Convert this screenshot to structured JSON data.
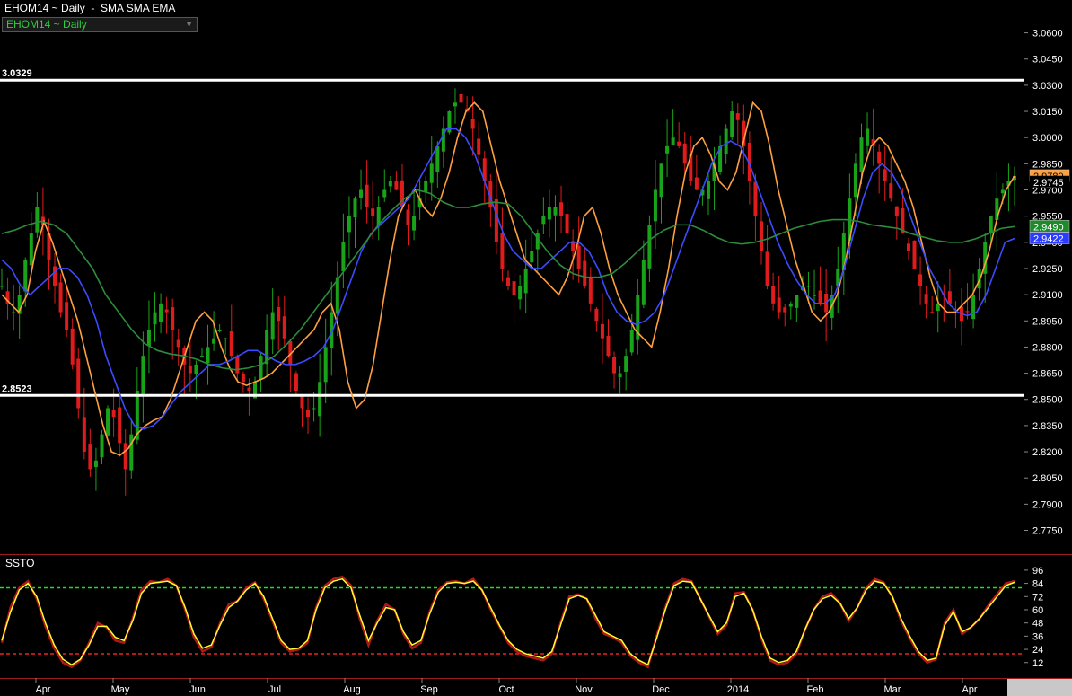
{
  "header": {
    "title": "EHOM14 ~ Daily  -  SMA SMA EMA",
    "symbol_dropdown": "EHOM14 ~ Daily"
  },
  "colors": {
    "background": "#000000",
    "up_candle": "#19a319",
    "down_candle": "#e01b1b",
    "sma_short": "#ffa040",
    "sma_long": "#3b4bff",
    "ema": "#2c8c3c",
    "support_resistance": "#ffffff",
    "stoch_k": "#b01818",
    "stoch_d": "#ffff30",
    "stoch_upper": "#22dd22",
    "stoch_lower": "#ee2222"
  },
  "chart_data": [
    {
      "type": "candlestick",
      "y_ticks": [
        "3.0600",
        "3.0450",
        "3.0300",
        "3.0150",
        "3.0000",
        "2.9850",
        "2.9700",
        "2.9550",
        "2.9400",
        "2.9250",
        "2.9100",
        "2.8950",
        "2.8800",
        "2.8650",
        "2.8500",
        "2.8350",
        "2.8200",
        "2.8050",
        "2.7900",
        "2.7750"
      ],
      "ylim": [
        2.766,
        3.0675
      ],
      "months": [
        "Apr",
        "May",
        "Jun",
        "Jul",
        "Aug",
        "Sep",
        "Oct",
        "Nov",
        "Dec",
        "2014",
        "Feb",
        "Mar",
        "Apr"
      ],
      "horizontal_lines": [
        {
          "value": 3.0329,
          "label": "3.0329"
        },
        {
          "value": 2.8523,
          "label": "2.8523"
        }
      ],
      "last_values": [
        {
          "label": "2.9780",
          "value": 2.978,
          "series": "sma_short"
        },
        {
          "label": "2.9745",
          "value": 2.9745,
          "series": "last_price"
        },
        {
          "label": "2.9490",
          "value": 2.949,
          "series": "ema"
        },
        {
          "label": "2.9422",
          "value": 2.9422,
          "series": "sma_long"
        }
      ],
      "close_series": [
        2.915,
        2.905,
        2.9,
        2.91,
        2.93,
        2.945,
        2.96,
        2.95,
        2.93,
        2.915,
        2.9,
        2.89,
        2.87,
        2.845,
        2.82,
        2.81,
        2.815,
        2.83,
        2.845,
        2.84,
        2.825,
        2.81,
        2.83,
        2.855,
        2.875,
        2.89,
        2.9,
        2.905,
        2.9,
        2.89,
        2.88,
        2.87,
        2.865,
        2.87,
        2.875,
        2.88,
        2.885,
        2.89,
        2.885,
        2.875,
        2.865,
        2.86,
        2.855,
        2.86,
        2.875,
        2.89,
        2.9,
        2.895,
        2.885,
        2.87,
        2.855,
        2.845,
        2.84,
        2.845,
        2.86,
        2.88,
        2.9,
        2.92,
        2.94,
        2.955,
        2.965,
        2.97,
        2.96,
        2.955,
        2.96,
        2.97,
        2.975,
        2.97,
        2.96,
        2.95,
        2.955,
        2.965,
        2.975,
        2.985,
        2.995,
        3.005,
        3.015,
        3.02,
        3.02,
        3.015,
        3.005,
        2.99,
        2.975,
        2.96,
        2.94,
        2.925,
        2.915,
        2.91,
        2.915,
        2.925,
        2.935,
        2.945,
        2.955,
        2.96,
        2.96,
        2.955,
        2.945,
        2.935,
        2.925,
        2.915,
        2.905,
        2.895,
        2.885,
        2.875,
        2.865,
        2.865,
        2.875,
        2.89,
        2.91,
        2.93,
        2.95,
        2.97,
        2.985,
        2.995,
        3.0,
        2.995,
        2.985,
        2.975,
        2.97,
        2.97,
        2.975,
        2.985,
        2.995,
        3.005,
        3.015,
        3.01,
        2.995,
        2.975,
        2.955,
        2.935,
        2.915,
        2.905,
        2.9,
        2.9,
        2.905,
        2.91,
        2.915,
        2.915,
        2.91,
        2.905,
        2.9,
        2.91,
        2.925,
        2.945,
        2.965,
        2.985,
        3.0,
        3.005,
        2.995,
        2.985,
        2.975,
        2.965,
        2.955,
        2.945,
        2.935,
        2.925,
        2.915,
        2.905,
        2.9,
        2.905,
        2.91,
        2.905,
        2.9,
        2.895,
        2.9,
        2.91,
        2.925,
        2.94,
        2.955,
        2.965,
        2.97,
        2.975,
        2.978
      ],
      "series": [
        {
          "key": "sma_short",
          "values": [
            2.91,
            2.905,
            2.9,
            2.91,
            2.935,
            2.952,
            2.94,
            2.925,
            2.91,
            2.895,
            2.875,
            2.855,
            2.835,
            2.82,
            2.818,
            2.822,
            2.83,
            2.835,
            2.838,
            2.84,
            2.85,
            2.865,
            2.88,
            2.895,
            2.9,
            2.895,
            2.88,
            2.868,
            2.86,
            2.858,
            2.86,
            2.862,
            2.865,
            2.87,
            2.875,
            2.88,
            2.885,
            2.89,
            2.9,
            2.905,
            2.89,
            2.86,
            2.845,
            2.85,
            2.87,
            2.9,
            2.93,
            2.955,
            2.965,
            2.97,
            2.96,
            2.955,
            2.965,
            2.98,
            3.0,
            3.015,
            3.02,
            3.015,
            2.995,
            2.975,
            2.96,
            2.945,
            2.93,
            2.925,
            2.92,
            2.915,
            2.91,
            2.92,
            2.935,
            2.955,
            2.96,
            2.945,
            2.925,
            2.91,
            2.9,
            2.89,
            2.885,
            2.88,
            2.9,
            2.925,
            2.955,
            2.98,
            2.995,
            3.0,
            2.99,
            2.975,
            2.97,
            2.98,
            3.0,
            3.02,
            3.015,
            2.995,
            2.97,
            2.95,
            2.93,
            2.915,
            2.9,
            2.895,
            2.9,
            2.91,
            2.93,
            2.955,
            2.98,
            2.995,
            3.0,
            2.995,
            2.985,
            2.975,
            2.96,
            2.94,
            2.92,
            2.905,
            2.9,
            2.9,
            2.905,
            2.91,
            2.92,
            2.935,
            2.955,
            2.97,
            2.978
          ]
        },
        {
          "key": "sma_long",
          "values": [
            2.93,
            2.925,
            2.915,
            2.91,
            2.915,
            2.92,
            2.925,
            2.925,
            2.92,
            2.91,
            2.895,
            2.875,
            2.86,
            2.845,
            2.835,
            2.833,
            2.835,
            2.84,
            2.848,
            2.855,
            2.86,
            2.865,
            2.87,
            2.87,
            2.872,
            2.875,
            2.878,
            2.878,
            2.875,
            2.872,
            2.87,
            2.87,
            2.872,
            2.875,
            2.88,
            2.89,
            2.905,
            2.92,
            2.935,
            2.945,
            2.95,
            2.955,
            2.96,
            2.965,
            2.975,
            2.985,
            2.995,
            3.005,
            3.005,
            3.0,
            2.99,
            2.975,
            2.96,
            2.945,
            2.935,
            2.93,
            2.925,
            2.925,
            2.93,
            2.935,
            2.94,
            2.94,
            2.935,
            2.925,
            2.91,
            2.9,
            2.895,
            2.893,
            2.895,
            2.9,
            2.91,
            2.925,
            2.94,
            2.955,
            2.97,
            2.985,
            2.995,
            2.998,
            2.995,
            2.985,
            2.97,
            2.955,
            2.94,
            2.928,
            2.918,
            2.91,
            2.905,
            2.905,
            2.91,
            2.925,
            2.945,
            2.965,
            2.98,
            2.985,
            2.98,
            2.97,
            2.955,
            2.94,
            2.925,
            2.915,
            2.905,
            2.9,
            2.898,
            2.9,
            2.91,
            2.925,
            2.94,
            2.9422
          ]
        },
        {
          "key": "ema",
          "values": [
            2.945,
            2.947,
            2.95,
            2.952,
            2.95,
            2.945,
            2.935,
            2.925,
            2.91,
            2.9,
            2.89,
            2.882,
            2.878,
            2.876,
            2.875,
            2.873,
            2.87,
            2.868,
            2.867,
            2.868,
            2.87,
            2.875,
            2.882,
            2.89,
            2.9,
            2.91,
            2.92,
            2.93,
            2.94,
            2.95,
            2.958,
            2.965,
            2.97,
            2.968,
            2.963,
            2.96,
            2.96,
            2.962,
            2.963,
            2.962,
            2.955,
            2.945,
            2.935,
            2.927,
            2.922,
            2.92,
            2.92,
            2.922,
            2.928,
            2.935,
            2.942,
            2.947,
            2.95,
            2.95,
            2.947,
            2.943,
            2.94,
            2.939,
            2.94,
            2.942,
            2.945,
            2.948,
            2.95,
            2.952,
            2.953,
            2.953,
            2.952,
            2.95,
            2.949,
            2.948,
            2.945,
            2.943,
            2.941,
            2.94,
            2.94,
            2.942,
            2.945,
            2.948,
            2.949
          ]
        }
      ]
    },
    {
      "type": "line",
      "title": "SSTO",
      "y_ticks": [
        "96",
        "84",
        "72",
        "60",
        "48",
        "36",
        "24",
        "12"
      ],
      "ylim": [
        2,
        100
      ],
      "upper_threshold": 80,
      "lower_threshold": 20,
      "series": [
        {
          "key": "stoch_k",
          "values": [
            30,
            62,
            80,
            86,
            70,
            45,
            25,
            12,
            8,
            14,
            30,
            48,
            44,
            32,
            30,
            52,
            78,
            86,
            85,
            88,
            82,
            60,
            35,
            22,
            26,
            48,
            65,
            68,
            80,
            85,
            70,
            50,
            30,
            22,
            24,
            30,
            62,
            82,
            88,
            90,
            82,
            52,
            28,
            50,
            65,
            60,
            38,
            25,
            30,
            58,
            78,
            85,
            86,
            84,
            88,
            78,
            60,
            45,
            30,
            22,
            18,
            16,
            14,
            20,
            48,
            72,
            74,
            70,
            52,
            38,
            35,
            30,
            18,
            12,
            8,
            36,
            62,
            84,
            88,
            86,
            70,
            54,
            38,
            46,
            75,
            76,
            60,
            34,
            14,
            10,
            12,
            20,
            42,
            60,
            72,
            75,
            66,
            50,
            62,
            80,
            88,
            85,
            72,
            50,
            34,
            20,
            12,
            15,
            48,
            60,
            38,
            44,
            52,
            64,
            74,
            84,
            86
          ]
        },
        {
          "key": "stoch_d",
          "values": [
            32,
            58,
            78,
            84,
            72,
            48,
            28,
            15,
            10,
            15,
            28,
            45,
            45,
            35,
            32,
            50,
            75,
            84,
            85,
            86,
            82,
            62,
            38,
            25,
            28,
            46,
            62,
            68,
            78,
            84,
            72,
            52,
            32,
            24,
            25,
            32,
            60,
            80,
            86,
            88,
            80,
            55,
            32,
            48,
            62,
            60,
            40,
            28,
            32,
            56,
            76,
            84,
            85,
            84,
            86,
            78,
            62,
            46,
            32,
            24,
            20,
            18,
            16,
            22,
            46,
            70,
            73,
            70,
            55,
            40,
            36,
            32,
            20,
            14,
            10,
            34,
            60,
            82,
            86,
            85,
            70,
            55,
            40,
            48,
            72,
            75,
            60,
            36,
            16,
            12,
            14,
            22,
            42,
            60,
            70,
            73,
            66,
            52,
            62,
            78,
            86,
            84,
            72,
            52,
            36,
            22,
            14,
            16,
            46,
            58,
            40,
            44,
            52,
            62,
            72,
            82,
            85
          ]
        }
      ]
    }
  ]
}
